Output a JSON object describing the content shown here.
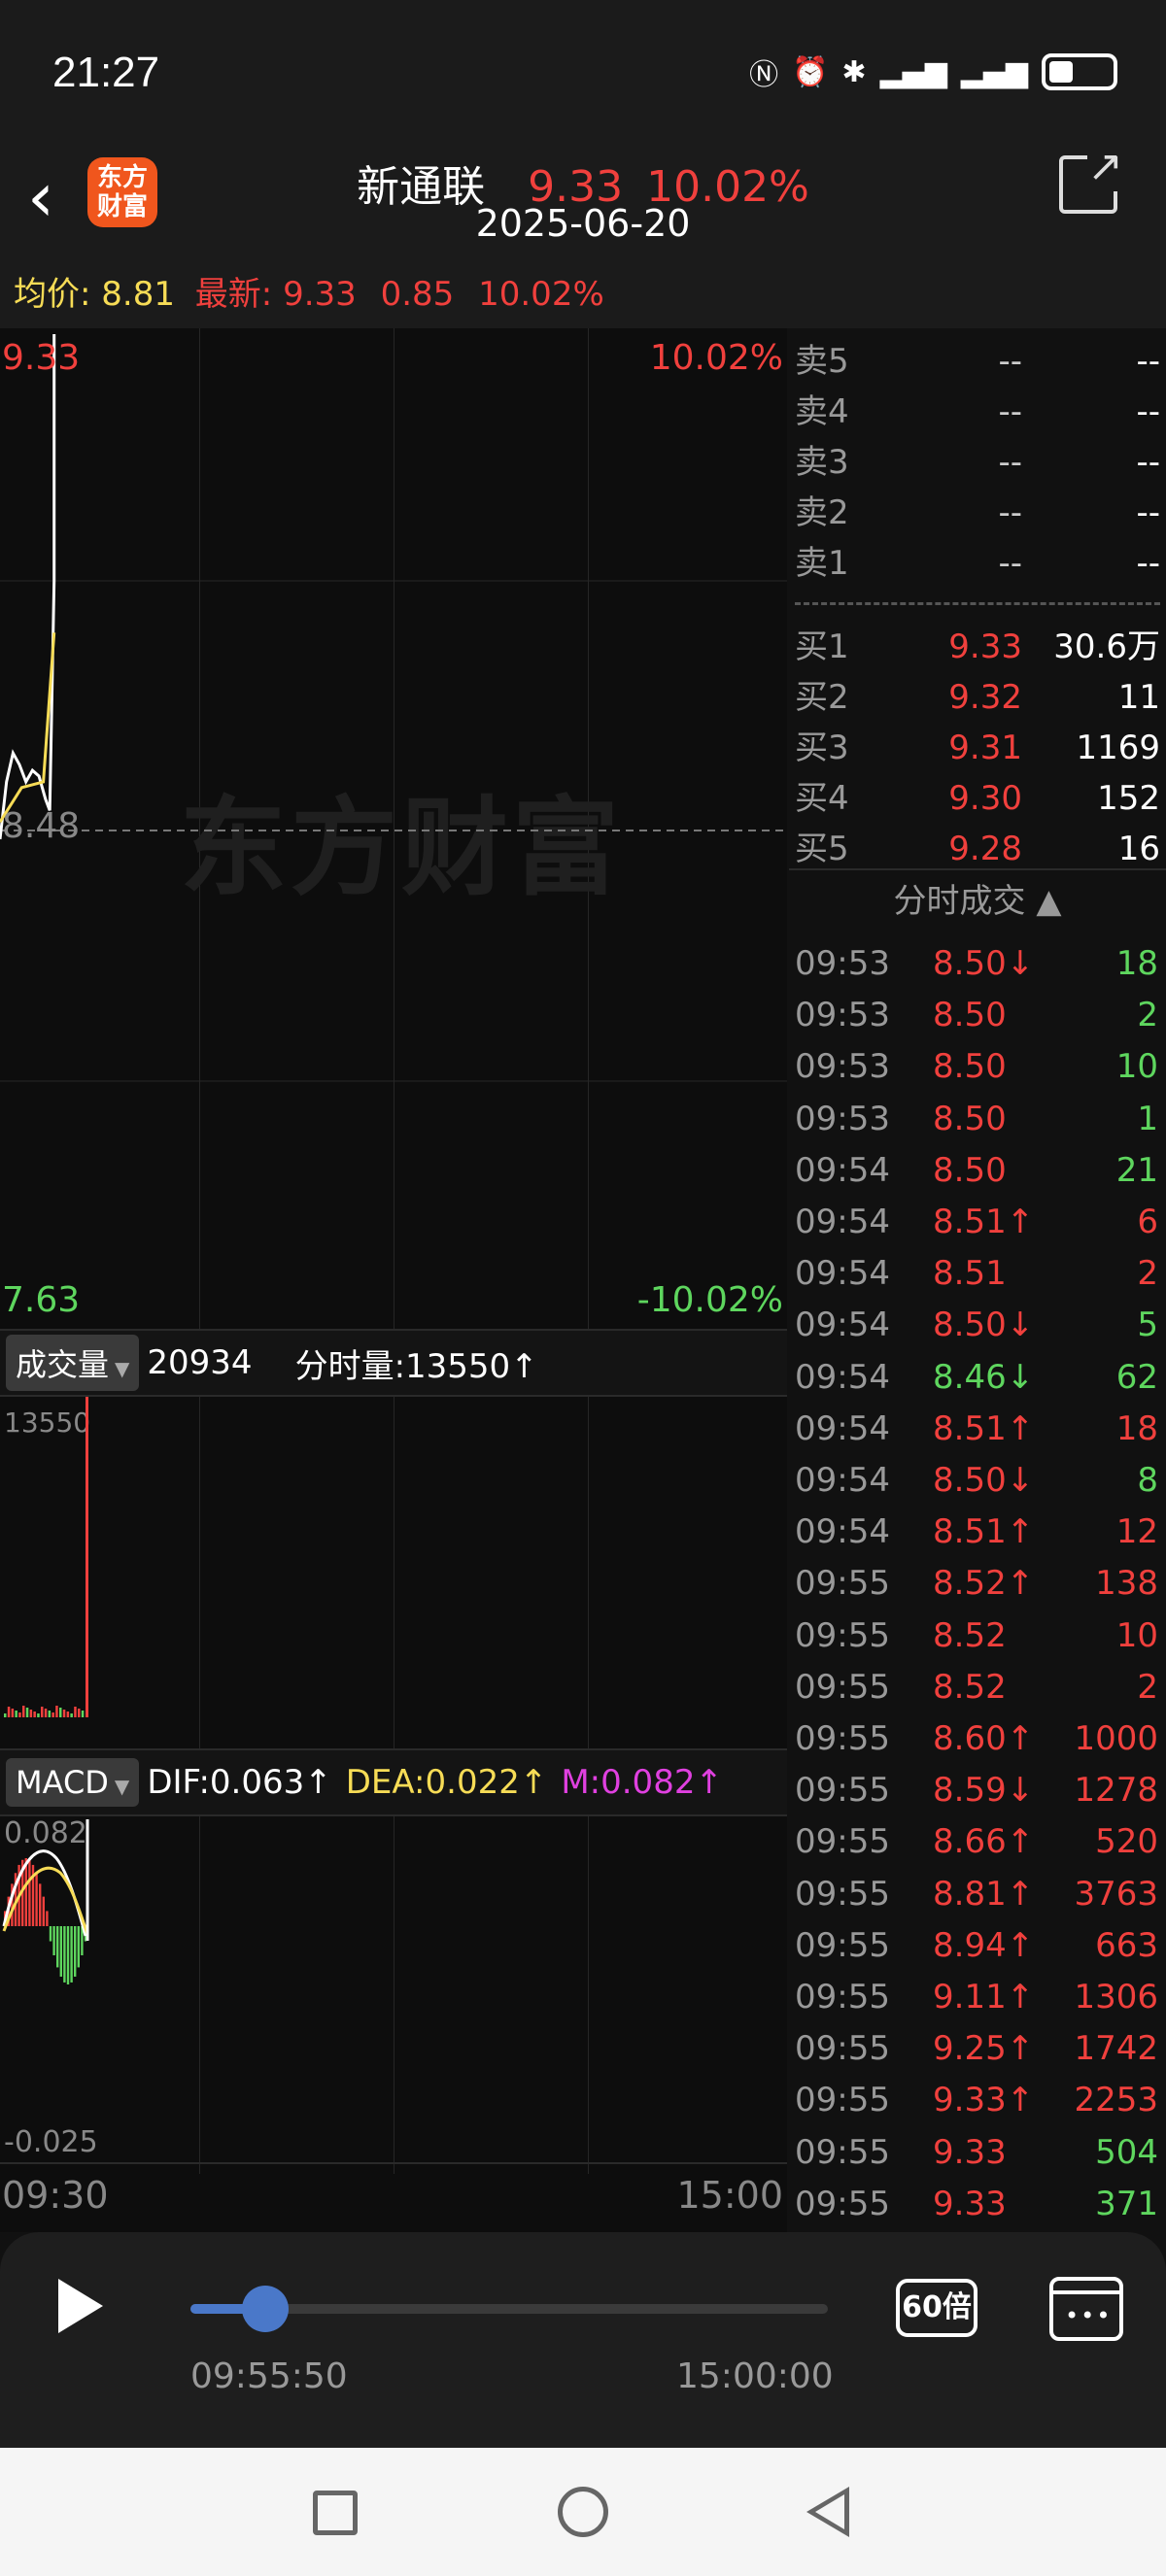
{
  "status": {
    "time": "21:27",
    "icons": [
      "nfc-icon",
      "alarm-icon",
      "bluetooth-icon",
      "signal-5g-icon",
      "signal-5g-icon",
      "battery-icon"
    ]
  },
  "header": {
    "stock_name": "新通联",
    "price": "9.33",
    "change_pct": "10.02%",
    "date": "2025-06-20",
    "logo_text": "东方\n财富"
  },
  "infoline": {
    "avg_label": "均价:",
    "avg_value": "8.81",
    "latest_label": "最新:",
    "latest_price": "9.33",
    "latest_change": "0.85",
    "latest_pct": "10.02%"
  },
  "chart": {
    "top_price": "9.33",
    "top_pct": "10.02%",
    "mid_price": "8.48",
    "bottom_price": "7.63",
    "bottom_pct": "-10.02%",
    "watermark": "东方财富",
    "volume_panel": {
      "selector": "成交量",
      "total": "20934",
      "label": "分时量:13550↑",
      "max_label": "13550"
    },
    "macd_panel": {
      "selector": "MACD",
      "dif": "DIF:0.063↑",
      "dea": "DEA:0.022↑",
      "m": "M:0.082↑",
      "max_label": "0.082",
      "min_label": "-0.025"
    },
    "time_start": "09:30",
    "time_end": "15:00"
  },
  "chart_data": {
    "type": "line",
    "title": "",
    "x_range": [
      "09:30",
      "15:00"
    ],
    "ylim": [
      7.63,
      9.33
    ],
    "series": [
      {
        "name": "",
        "x": [
          "09:30",
          "09:33",
          "09:36",
          "09:39",
          "09:42",
          "09:45",
          "09:48",
          "09:51",
          "09:53",
          "09:55",
          "09:55"
        ],
        "values": [
          8.45,
          8.55,
          8.6,
          8.58,
          8.55,
          8.57,
          8.56,
          8.52,
          8.5,
          8.9,
          9.33
        ]
      },
      {
        "name": "均价",
        "x": [
          "09:30",
          "09:40",
          "09:50",
          "09:55"
        ],
        "values": [
          8.48,
          8.54,
          8.55,
          8.81
        ]
      }
    ]
  },
  "book": {
    "sell": [
      {
        "label": "卖5",
        "price": "--",
        "vol": "--"
      },
      {
        "label": "卖4",
        "price": "--",
        "vol": "--"
      },
      {
        "label": "卖3",
        "price": "--",
        "vol": "--"
      },
      {
        "label": "卖2",
        "price": "--",
        "vol": "--"
      },
      {
        "label": "卖1",
        "price": "--",
        "vol": "--"
      }
    ],
    "buy": [
      {
        "label": "买1",
        "price": "9.33",
        "vol": "30.6万"
      },
      {
        "label": "买2",
        "price": "9.32",
        "vol": "11"
      },
      {
        "label": "买3",
        "price": "9.31",
        "vol": "1169"
      },
      {
        "label": "买4",
        "price": "9.30",
        "vol": "152"
      },
      {
        "label": "买5",
        "price": "9.28",
        "vol": "16"
      }
    ],
    "trades_title": "分时成交 ▲",
    "trades": [
      {
        "t": "09:53",
        "p": "8.50↓",
        "v": "18",
        "pc": "red",
        "vc": "green"
      },
      {
        "t": "09:53",
        "p": "8.50",
        "v": "2",
        "pc": "red",
        "vc": "green"
      },
      {
        "t": "09:53",
        "p": "8.50",
        "v": "10",
        "pc": "red",
        "vc": "green"
      },
      {
        "t": "09:53",
        "p": "8.50",
        "v": "1",
        "pc": "red",
        "vc": "green"
      },
      {
        "t": "09:54",
        "p": "8.50",
        "v": "21",
        "pc": "red",
        "vc": "green"
      },
      {
        "t": "09:54",
        "p": "8.51↑",
        "v": "6",
        "pc": "red",
        "vc": "red"
      },
      {
        "t": "09:54",
        "p": "8.51",
        "v": "2",
        "pc": "red",
        "vc": "red"
      },
      {
        "t": "09:54",
        "p": "8.50↓",
        "v": "5",
        "pc": "red",
        "vc": "green"
      },
      {
        "t": "09:54",
        "p": "8.46↓",
        "v": "62",
        "pc": "green",
        "vc": "green"
      },
      {
        "t": "09:54",
        "p": "8.51↑",
        "v": "18",
        "pc": "red",
        "vc": "red"
      },
      {
        "t": "09:54",
        "p": "8.50↓",
        "v": "8",
        "pc": "red",
        "vc": "green"
      },
      {
        "t": "09:54",
        "p": "8.51↑",
        "v": "12",
        "pc": "red",
        "vc": "red"
      },
      {
        "t": "09:55",
        "p": "8.52↑",
        "v": "138",
        "pc": "red",
        "vc": "red"
      },
      {
        "t": "09:55",
        "p": "8.52",
        "v": "10",
        "pc": "red",
        "vc": "red"
      },
      {
        "t": "09:55",
        "p": "8.52",
        "v": "2",
        "pc": "red",
        "vc": "red"
      },
      {
        "t": "09:55",
        "p": "8.60↑",
        "v": "1000",
        "pc": "red",
        "vc": "red"
      },
      {
        "t": "09:55",
        "p": "8.59↓",
        "v": "1278",
        "pc": "red",
        "vc": "red"
      },
      {
        "t": "09:55",
        "p": "8.66↑",
        "v": "520",
        "pc": "red",
        "vc": "red"
      },
      {
        "t": "09:55",
        "p": "8.81↑",
        "v": "3763",
        "pc": "red",
        "vc": "red"
      },
      {
        "t": "09:55",
        "p": "8.94↑",
        "v": "663",
        "pc": "red",
        "vc": "red"
      },
      {
        "t": "09:55",
        "p": "9.11↑",
        "v": "1306",
        "pc": "red",
        "vc": "red"
      },
      {
        "t": "09:55",
        "p": "9.25↑",
        "v": "1742",
        "pc": "red",
        "vc": "red"
      },
      {
        "t": "09:55",
        "p": "9.33↑",
        "v": "2253",
        "pc": "red",
        "vc": "red"
      },
      {
        "t": "09:55",
        "p": "9.33",
        "v": "504",
        "pc": "red",
        "vc": "green"
      },
      {
        "t": "09:55",
        "p": "9.33",
        "v": "371",
        "pc": "red",
        "vc": "green"
      }
    ]
  },
  "playback": {
    "current": "09:55:50",
    "end": "15:00:00",
    "speed": "60倍",
    "progress": 0.09
  },
  "colors": {
    "up": "#f0403d",
    "down": "#5ed65e",
    "avg": "#f7dc56",
    "accent": "#4a78c9"
  }
}
